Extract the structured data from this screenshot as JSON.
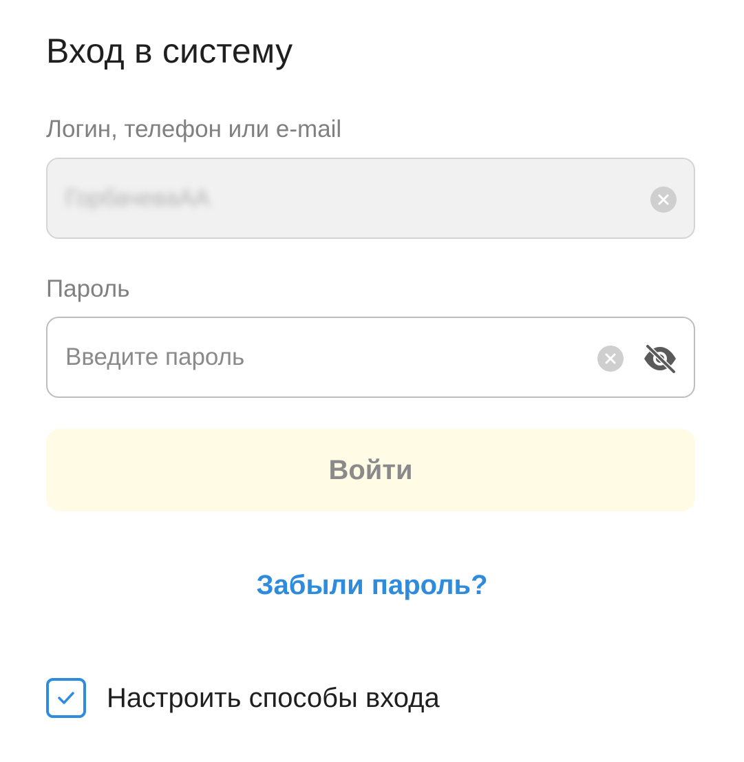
{
  "page": {
    "title": "Вход в систему"
  },
  "login": {
    "label": "Логин, телефон или e-mail",
    "value": "ГорбачеваАА",
    "clear_icon": "close-circle-icon"
  },
  "password": {
    "label": "Пароль",
    "placeholder": "Введите пароль",
    "clear_icon": "close-circle-icon",
    "visibility_icon": "eye-off-icon"
  },
  "actions": {
    "login_button_label": "Войти",
    "forgot_password_label": "Забыли пароль?"
  },
  "options": {
    "configure_login_methods_label": "Настроить способы входа",
    "configure_login_methods_checked": true
  },
  "colors": {
    "accent": "#2f8bdb",
    "button_background": "#fffbe5",
    "button_text": "#8a8a8a",
    "input_disabled_background": "#f1f1f1"
  }
}
